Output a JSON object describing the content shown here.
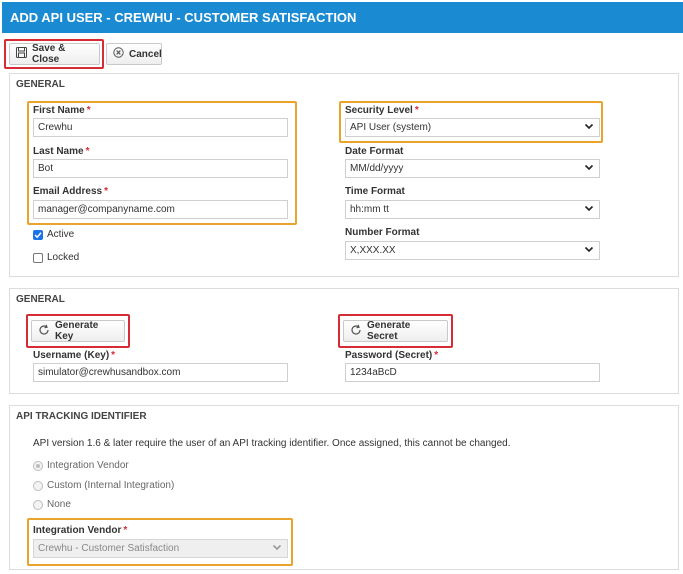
{
  "window": {
    "title": "ADD API USER - CREWHU - CUSTOMER SATISFACTION"
  },
  "toolbar": {
    "save_label": "Save & Close",
    "cancel_label": "Cancel"
  },
  "general": {
    "heading": "GENERAL",
    "first_name": {
      "label": "First Name",
      "value": "Crewhu"
    },
    "last_name": {
      "label": "Last Name",
      "value": "Bot"
    },
    "email": {
      "label": "Email Address",
      "value": "manager@companyname.com"
    },
    "active": {
      "label": "Active",
      "checked": true
    },
    "locked": {
      "label": "Locked",
      "checked": false
    },
    "security_level": {
      "label": "Security Level",
      "value": "API User (system)"
    },
    "date_format": {
      "label": "Date Format",
      "value": "MM/dd/yyyy"
    },
    "time_format": {
      "label": "Time Format",
      "value": "hh:mm tt"
    },
    "number_format": {
      "label": "Number Format",
      "value": "X,XXX.XX"
    },
    "required_mark": "*"
  },
  "credentials": {
    "heading": "GENERAL",
    "generate_key_label": "Generate Key",
    "generate_secret_label": "Generate Secret",
    "username": {
      "label": "Username (Key)",
      "value": "simulator@crewhusandbox.com"
    },
    "password": {
      "label": "Password (Secret)",
      "value": "1234aBcD"
    }
  },
  "tracking": {
    "heading": "API TRACKING IDENTIFIER",
    "description": "API version 1.6 & later require the user of an API tracking identifier. Once assigned, this cannot be changed.",
    "options": [
      "Integration Vendor",
      "Custom (Internal Integration)",
      "None"
    ],
    "selected_option": "Integration Vendor",
    "vendor": {
      "label": "Integration Vendor",
      "value": "Crewhu - Customer Satisfaction"
    }
  },
  "colors": {
    "title_bar": "#1a8bd2",
    "required": "#d62c35",
    "highlight_red": "#d62c35",
    "highlight_orange": "#eba42b"
  },
  "icons": {
    "save": "floppy-disk-icon",
    "cancel": "cancel-circle-icon",
    "refresh": "refresh-icon",
    "dropdown": "chevron-down-icon"
  }
}
